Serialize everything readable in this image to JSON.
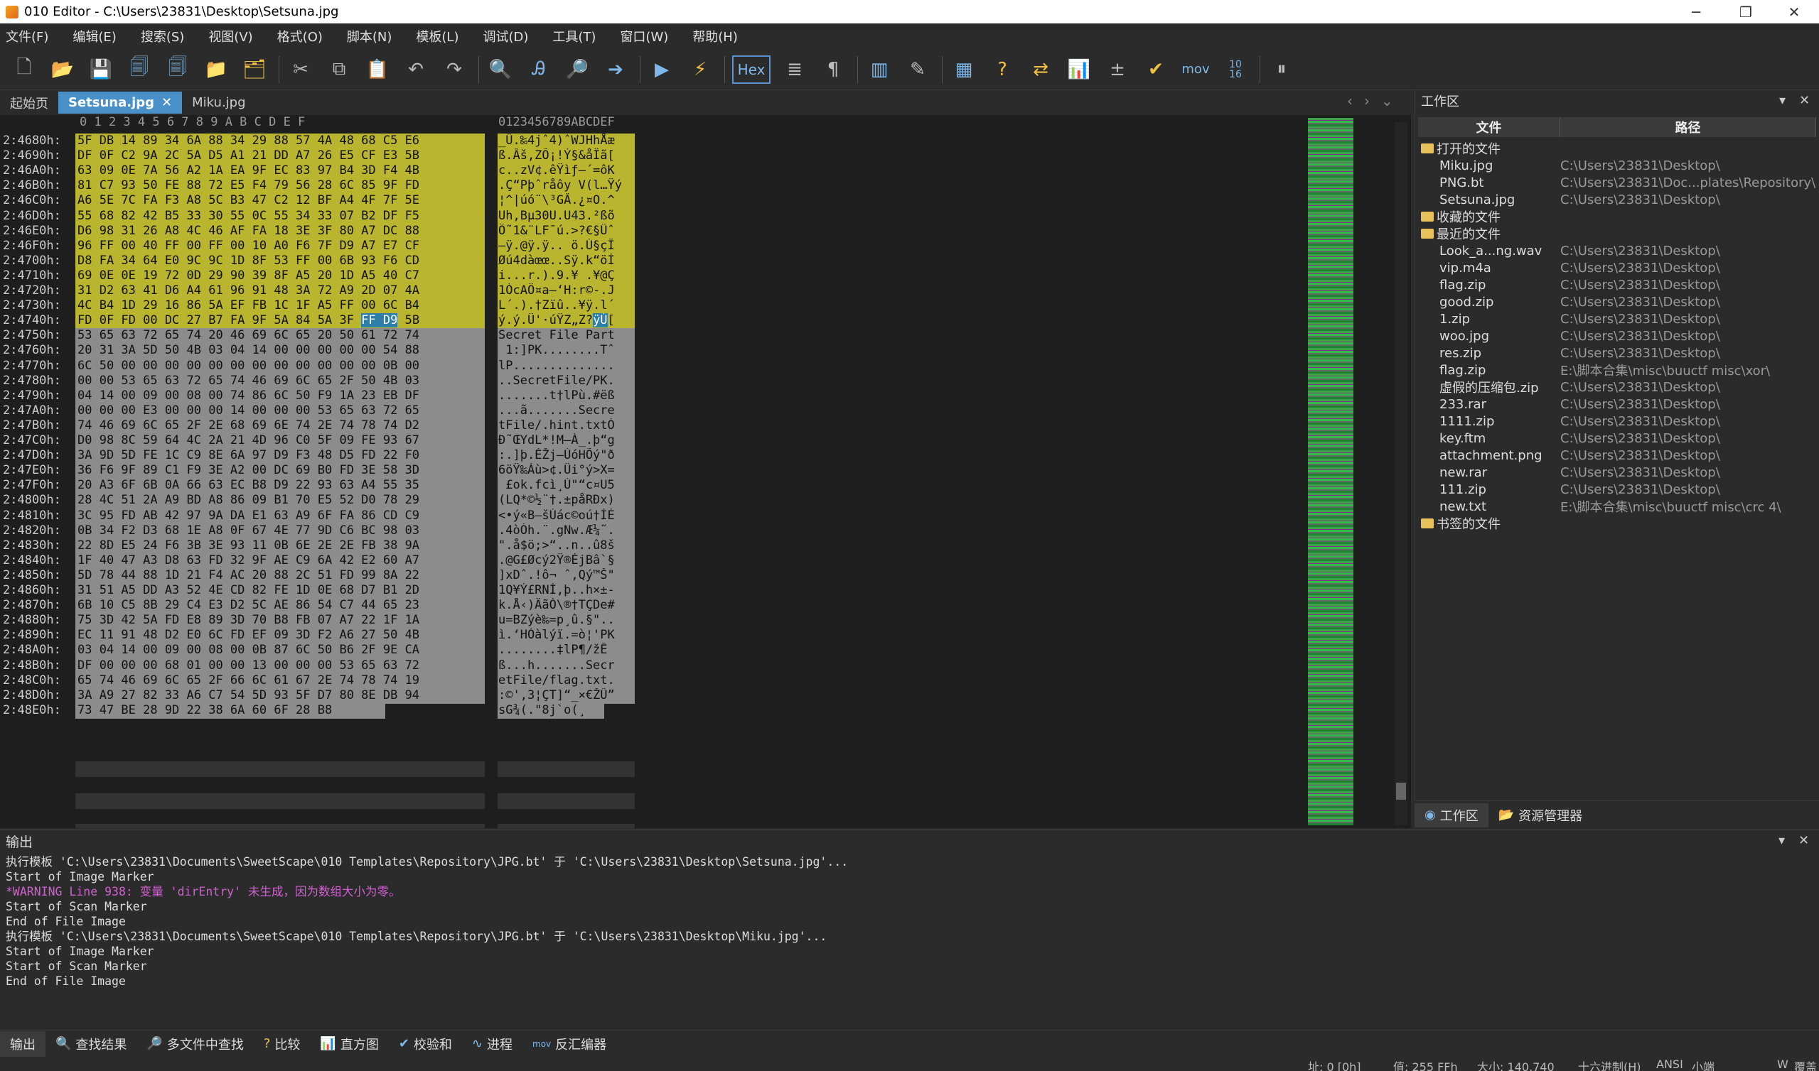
{
  "window": {
    "title": "010 Editor - C:\\Users\\23831\\Desktop\\Setsuna.jpg",
    "minimize": "─",
    "maximize": "❐",
    "close": "✕"
  },
  "menu": [
    "文件(F)",
    "编辑(E)",
    "搜索(S)",
    "视图(V)",
    "格式(O)",
    "脚本(N)",
    "模板(L)",
    "调试(D)",
    "工具(T)",
    "窗口(W)",
    "帮助(H)"
  ],
  "toolbar": {
    "hex_label": "Hex",
    "mov_label": "mov",
    "base_label": "10\n16"
  },
  "tabs": [
    {
      "label": "起始页"
    },
    {
      "label": "Setsuna.jpg",
      "close": "✕"
    },
    {
      "label": "Miku.jpg"
    }
  ],
  "hex": {
    "col_header_hex": "0  1  2  3  4  5  6  7  8  9  A  B  C  D  E  F",
    "col_header_ascii": "0123456789ABCDEF",
    "rows": [
      [
        "2:4680h:",
        "5F DB 14 89 34 6A 88 34 29 88 57 4A 48 68 C5 E6",
        "_Û.‰4jˆ4)ˆWJHhÅæ",
        "hl"
      ],
      [
        "2:4690h:",
        "DF 0F C2 9A 2C 5A D5 A1 21 DD A7 26 E5 CF E3 5B",
        "ß.Âš,ZÕ¡!Ý§&åÏã[",
        "hl"
      ],
      [
        "2:46A0h:",
        "63 09 0E 7A 56 A2 1A EA 9F EC 83 97 B4 3D F4 4B",
        "c..zV¢.êŸìƒ—´=ôK",
        "hl"
      ],
      [
        "2:46B0h:",
        "81 C7 93 50 FE 88 72 E5 F4 79 56 28 6C 85 9F FD",
        ".Ç“Pþˆråôy V(l…Ÿý",
        "hl"
      ],
      [
        "2:46C0h:",
        "A6 5E 7C FA F3 A8 5C B3 47 C2 12 BF A4 4F 7F 5E",
        "¦^|úó¨\\³GÂ.¿¤O.^",
        "hl"
      ],
      [
        "2:46D0h:",
        "55 68 82 42 B5 33 30 55 0C 55 34 33 07 B2 DF F5",
        "Uh‚Bµ30U.U43.²ßõ",
        "hl"
      ],
      [
        "2:46E0h:",
        "D6 98 31 26 A8 4C 46 AF FA 18 3E 3F 80 A7 DC 88",
        "Ö˜1&¨LF¯ú.>?€§Üˆ",
        "hl"
      ],
      [
        "2:46F0h:",
        "96 FF 00 40 FF 00 FF 00 10 A0 F6 7F D9 A7 E7 CF",
        "–ÿ.@ÿ.ÿ.. ö.Ù§çÏ",
        "hl"
      ],
      [
        "2:4700h:",
        "D8 FA 34 64 E0 9C 9C 1D 8F 53 FF 00 6B 93 F6 CD",
        "Øú4dàœœ..Sÿ.k“öÍ",
        "hl"
      ],
      [
        "2:4710h:",
        "69 0E 0E 19 72 0D 29 90 39 8F A5 20 1D A5 40 C7",
        "i...r.).9.¥ .¥@Ç",
        "hl"
      ],
      [
        "2:4720h:",
        "31 D2 63 41 D6 A4 61 96 91 48 3A 72 A9 2D 07 4A",
        "1ÒcAÖ¤a–‘H:r©-.J",
        "hl"
      ],
      [
        "2:4730h:",
        "4C B4 1D 29 16 86 5A EF FB 1C 1F A5 FF 00 6C B4",
        "L´.).†Zïû..¥ÿ.l´",
        "hl"
      ],
      [
        "2:4740h:",
        "FD 0F FD 00 DC 27 B7 FA 9F 5A 84 5A 3F FF D9 5B",
        "ý.ý.Ü'·úŸZ„Z?ÿÙ[",
        "hlsel"
      ],
      [
        "2:4750h:",
        "53 65 63 72 65 74 20 46 69 6C 65 20 50 61 72 74",
        "Secret File Part",
        "gr"
      ],
      [
        "2:4760h:",
        "20 31 3A 5D 50 4B 03 04 14 00 00 00 00 00 54 88",
        " 1:]PK........Tˆ",
        "gr"
      ],
      [
        "2:4770h:",
        "6C 50 00 00 00 00 00 00 00 00 00 00 00 00 0B 00",
        "lP..............",
        "gr"
      ],
      [
        "2:4780h:",
        "00 00 53 65 63 72 65 74 46 69 6C 65 2F 50 4B 03",
        "..SecretFile/PK.",
        "gr"
      ],
      [
        "2:4790h:",
        "04 14 00 09 00 08 00 74 86 6C 50 F9 1A 23 EB DF",
        ".......t†lPù.#ëß",
        "gr"
      ],
      [
        "2:47A0h:",
        "00 00 00 E3 00 00 00 14 00 00 00 53 65 63 72 65",
        "...ã.......Secre",
        "gr"
      ],
      [
        "2:47B0h:",
        "74 46 69 6C 65 2F 2E 68 69 6E 74 2E 74 78 74 D2",
        "tFile/.hint.txtÒ",
        "gr"
      ],
      [
        "2:47C0h:",
        "D0 98 8C 59 64 4C 2A 21 4D 96 C0 5F 09 FE 93 67",
        "Ð˜ŒYdL*!M–À_.þ“g",
        "gr"
      ],
      [
        "2:47D0h:",
        "3A 9D 5D FE 1C C9 8E 6A 97 D9 F3 48 D5 FD 22 F0",
        ":.]þ.ÉŽj—ÙóHÕý\"ð",
        "gr"
      ],
      [
        "2:47E0h:",
        "36 F6 9F 89 C1 F9 3E A2 00 DC 69 B0 FD 3E 58 3D",
        "6öŸ‰Áù>¢.Üi°ý>X=",
        "gr"
      ],
      [
        "2:47F0h:",
        "20 A3 6F 6B 0A 66 63 EC B8 D9 22 93 63 A4 55 35",
        " £ok.fcì¸Ù\"“c¤U5",
        "gr"
      ],
      [
        "2:4800h:",
        "28 4C 51 2A A9 BD A8 86 09 B1 70 E5 52 D0 78 29",
        "(LQ*©½¨†.±påRÐx)",
        "gr"
      ],
      [
        "2:4810h:",
        "3C 95 FD AB 42 97 9A DA E1 63 A9 6F FA 86 CD C9",
        "<•ý«B—šÚác©oú†ÍÉ",
        "gr"
      ],
      [
        "2:4820h:",
        "0B 34 F2 D3 68 1E A8 0F 67 4E 77 9D C6 BC 98 03",
        ".4òÓh.¨.gNw.Æ¼˜.",
        "gr"
      ],
      [
        "2:4830h:",
        "22 8D E5 24 F6 3B 3E 93 11 0B 6E 2E 2E FB 38 9A",
        "\".å$ö;>“..n..û8š",
        "gr"
      ],
      [
        "2:4840h:",
        "1F 40 47 A3 D8 63 FD 32 9F AE C9 6A 42 E2 60 A7",
        ".@G£Øcý2Ÿ®ÉjBâ`§",
        "gr"
      ],
      [
        "2:4850h:",
        "5D 78 44 88 1D 21 F4 AC 20 88 2C 51 FD 99 8A 22",
        "]xDˆ.!ô¬ ˆ,Qý™Š\"",
        "gr"
      ],
      [
        "2:4860h:",
        "31 51 A5 DD A3 52 4E CD 82 FE 1D 0E 68 D7 B1 2D",
        "1Q¥Ý£RNÍ‚þ..h×±-",
        "gr"
      ],
      [
        "2:4870h:",
        "6B 10 C5 8B 29 C4 E3 D2 5C AE 86 54 C7 44 65 23",
        "k.Å‹)ÄãÒ\\®†TÇDe#",
        "gr"
      ],
      [
        "2:4880h:",
        "75 3D 42 5A FD E8 89 3D 70 B8 FB 07 A7 22 1F 1A",
        "u=BZýè‰=p¸û.§\"..",
        "gr"
      ],
      [
        "2:4890h:",
        "EC 11 91 48 D2 E0 6C FD EF 09 3D F2 A6 27 50 4B",
        "ì.‘HÒàlýï.=ò¦'PK",
        "gr"
      ],
      [
        "2:48A0h:",
        "03 04 14 00 09 00 08 00 0B 87 6C 50 B6 2F 9E CA",
        "........‡lP¶/žÊ",
        "gr"
      ],
      [
        "2:48B0h:",
        "DF 00 00 00 68 01 00 00 13 00 00 00 53 65 63 72",
        "ß...h.......Secr",
        "gr"
      ],
      [
        "2:48C0h:",
        "65 74 46 69 6C 65 2F 66 6C 61 67 2E 74 78 74 19",
        "etFile/flag.txt.",
        "gr"
      ],
      [
        "2:48D0h:",
        "3A A9 27 82 33 A6 C7 54 5D 93 5F D7 80 8E DB 94",
        ":©'‚3¦ÇT]“_×€ŽÛ”",
        "gr"
      ],
      [
        "2:48E0h:",
        "73 47 BE 28 9D 22 38 6A 60 6F 28 B8",
        "sG¾(.\"8j`o(¸",
        "grshort"
      ]
    ]
  },
  "workspace": {
    "title": "工作区",
    "col_file": "文件",
    "col_path": "路径",
    "open_files_label": "打开的文件",
    "open_files": [
      {
        "name": "Miku.jpg",
        "path": "C:\\Users\\23831\\Desktop\\"
      },
      {
        "name": "PNG.bt",
        "path": "C:\\Users\\23831\\Doc...plates\\Repository\\"
      },
      {
        "name": "Setsuna.jpg",
        "path": "C:\\Users\\23831\\Desktop\\"
      }
    ],
    "favorites_label": "收藏的文件",
    "recent_label": "最近的文件",
    "recent_files": [
      {
        "name": "Look_a...ng.wav",
        "path": "C:\\Users\\23831\\Desktop\\"
      },
      {
        "name": "vip.m4a",
        "path": "C:\\Users\\23831\\Desktop\\"
      },
      {
        "name": "flag.zip",
        "path": "C:\\Users\\23831\\Desktop\\"
      },
      {
        "name": "good.zip",
        "path": "C:\\Users\\23831\\Desktop\\"
      },
      {
        "name": "1.zip",
        "path": "C:\\Users\\23831\\Desktop\\"
      },
      {
        "name": "woo.jpg",
        "path": "C:\\Users\\23831\\Desktop\\"
      },
      {
        "name": "res.zip",
        "path": "C:\\Users\\23831\\Desktop\\"
      },
      {
        "name": "flag.zip",
        "path": "E:\\脚本合集\\misc\\buuctf misc\\xor\\"
      },
      {
        "name": "虚假的压缩包.zip",
        "path": "C:\\Users\\23831\\Desktop\\"
      },
      {
        "name": "233.rar",
        "path": "C:\\Users\\23831\\Desktop\\"
      },
      {
        "name": "1111.zip",
        "path": "C:\\Users\\23831\\Desktop\\"
      },
      {
        "name": "key.ftm",
        "path": "C:\\Users\\23831\\Desktop\\"
      },
      {
        "name": "attachment.png",
        "path": "C:\\Users\\23831\\Desktop\\"
      },
      {
        "name": "new.rar",
        "path": "C:\\Users\\23831\\Desktop\\"
      },
      {
        "name": "111.zip",
        "path": "C:\\Users\\23831\\Desktop\\"
      },
      {
        "name": "new.txt",
        "path": "E:\\脚本合集\\misc\\buuctf misc\\crc 4\\"
      }
    ],
    "bookmarks_label": "书签的文件",
    "bottom_tabs": [
      "工作区",
      "资源管理器"
    ]
  },
  "output": {
    "title": "输出",
    "lines": [
      "执行模板 'C:\\Users\\23831\\Documents\\SweetScape\\010 Templates\\Repository\\JPG.bt' 于 'C:\\Users\\23831\\Desktop\\Setsuna.jpg'...",
      "Start of Image Marker",
      "*WARNING Line 938: 变量 'dirEntry' 未生成，因为数组大小为零。",
      "Start of Scan Marker",
      "End of File Image",
      "执行模板 'C:\\Users\\23831\\Documents\\SweetScape\\010 Templates\\Repository\\JPG.bt' 于 'C:\\Users\\23831\\Desktop\\Miku.jpg'...",
      "Start of Image Marker",
      "Start of Scan Marker",
      "End of File Image"
    ]
  },
  "bottom_tabs": [
    "输出",
    "查找结果",
    "多文件中查找",
    "比较",
    "直方图",
    "校验和",
    "进程",
    "反汇编器"
  ],
  "statusbar": {
    "pos": "址: 0 [0h]",
    "value": "值: 255 FFh",
    "size": "大小: 140,740",
    "mode": "十六进制(H)",
    "enc": "ANSI",
    "le": "小端",
    "ins": "W",
    "extra": "覆盖"
  }
}
